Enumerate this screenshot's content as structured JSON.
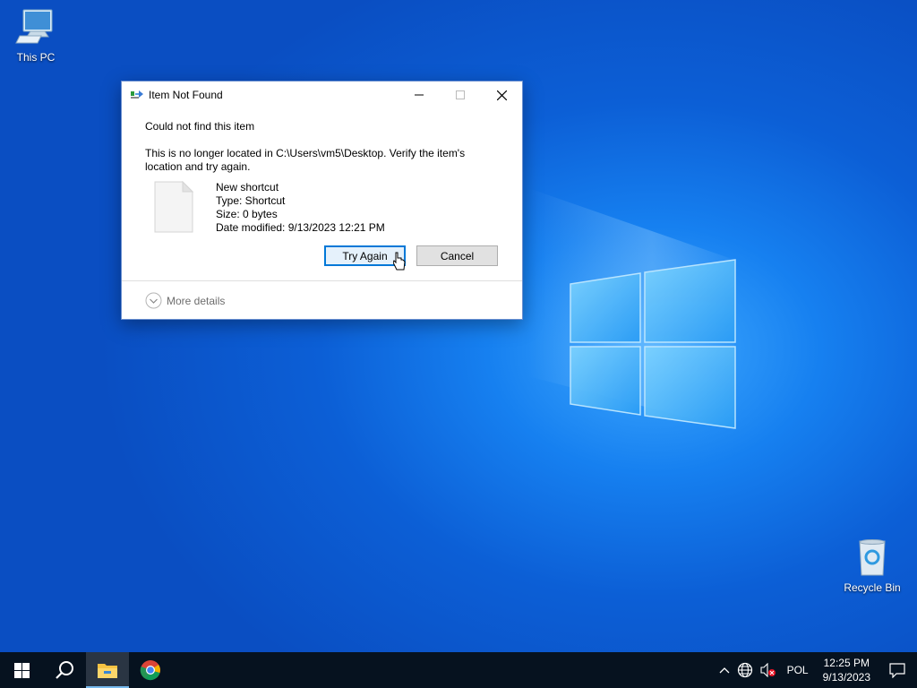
{
  "desktop": {
    "icons": [
      {
        "label": "This PC",
        "icon": "computer-icon"
      },
      {
        "label": "Recycle Bin",
        "icon": "recycle-bin-icon"
      }
    ]
  },
  "dialog": {
    "title": "Item Not Found",
    "headline": "Could not find this item",
    "message": "This is no longer located in C:\\Users\\vm5\\Desktop. Verify the item's location and try again.",
    "file": {
      "name": "New shortcut",
      "type": "Type: Shortcut",
      "size": "Size: 0 bytes",
      "modified": "Date modified: 9/13/2023 12:21 PM"
    },
    "buttons": {
      "try_again": "Try Again",
      "cancel": "Cancel"
    },
    "more_details": "More details"
  },
  "taskbar": {
    "pinned": [
      "start-icon",
      "search-icon",
      "file-explorer-icon",
      "chrome-icon"
    ],
    "tray": {
      "language": "POL",
      "time": "12:25 PM",
      "date": "9/13/2023"
    }
  },
  "colors": {
    "accent": "#0078d7",
    "taskbar": "#06121f",
    "desktop": "#0c5fd6"
  }
}
